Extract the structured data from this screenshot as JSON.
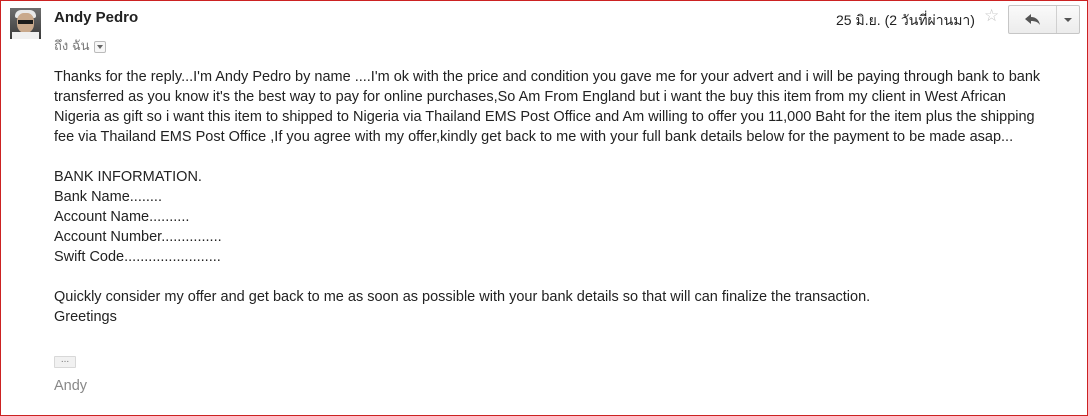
{
  "header": {
    "sender_name": "Andy Pedro",
    "recipient_label": "ถึง ฉัน",
    "date": "25 มิ.ย. (2 วันที่ผ่านมา)"
  },
  "icons": {
    "star": "star-outline-icon",
    "reply": "reply-arrow-icon",
    "more": "chevron-down-icon"
  },
  "message": {
    "paragraph1": "Thanks for the reply...I'm Andy Pedro by name ....I'm ok with the price and condition you gave me for your advert and i will be paying through bank to bank transferred as you know it's the best way to pay for online purchases,So Am From England but i want the buy this item from my client in West African Nigeria as gift so i want this item to shipped to Nigeria via Thailand EMS Post Office and Am willing to offer you 11,000 Baht for the item plus the shipping fee via Thailand EMS Post Office ,If you agree with my offer,kindly get back to me with your full bank details below for the payment to be made asap...",
    "bank_heading": "BANK INFORMATION.",
    "bank_lines": [
      "Bank Name........",
      "Account Name..........",
      "Account Number...............",
      "Swift Code........................"
    ],
    "closing": "Quickly consider my offer and get back to me as soon as possible with your bank details so that will can finalize the transaction.",
    "greeting": "Greetings",
    "show_trimmed_label": "...",
    "signature": "Andy"
  },
  "colors": {
    "frame_border": "#cc2222",
    "text": "#222222",
    "muted": "#888888"
  }
}
